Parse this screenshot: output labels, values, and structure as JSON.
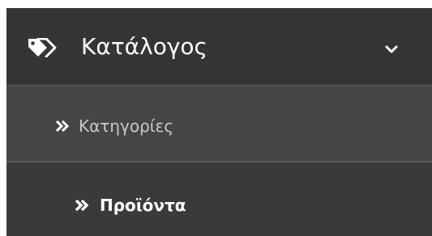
{
  "menu": {
    "label": "Κατάλογος",
    "icon": "tags-icon",
    "toggle_icon": "chevron-down-icon",
    "expanded": true,
    "items": [
      {
        "label": "Κατηγορίες",
        "icon": "double-chevron-right-icon",
        "active": false
      },
      {
        "label": "Προϊόντα",
        "icon": "double-chevron-right-icon",
        "active": true
      }
    ]
  },
  "colors": {
    "header_bg": "#353535",
    "item_bg": "#454545",
    "active_item_bg": "#3a3a3a",
    "text": "#ffffff",
    "muted_text": "#c9c9c9"
  }
}
